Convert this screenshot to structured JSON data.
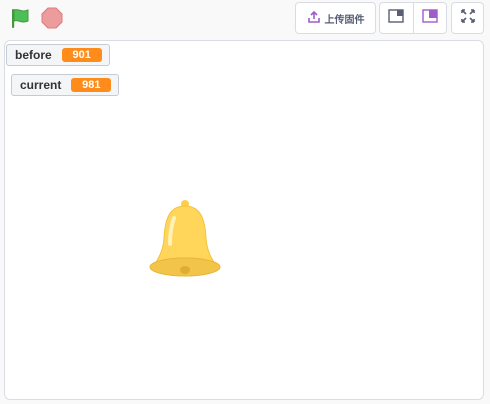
{
  "toolbar": {
    "green_flag_icon": "green-flag-icon",
    "stop_icon": "stop-icon",
    "upload_label": "上传固件",
    "upload_icon": "upload-icon",
    "small_stage_icon": "small-stage-icon",
    "normal_stage_icon": "normal-stage-icon",
    "fullscreen_icon": "fullscreen-icon"
  },
  "stage": {
    "monitors": [
      {
        "label": "before",
        "value": "901"
      },
      {
        "label": "current",
        "value": "981"
      }
    ],
    "sprite": "bell-sprite"
  },
  "colors": {
    "flag": "#4cbf56",
    "stop": "#ec9c9c",
    "monitor_value": "#ff8c1a",
    "upload_accent": "#a05cc8",
    "bell": "#ffd55a"
  }
}
